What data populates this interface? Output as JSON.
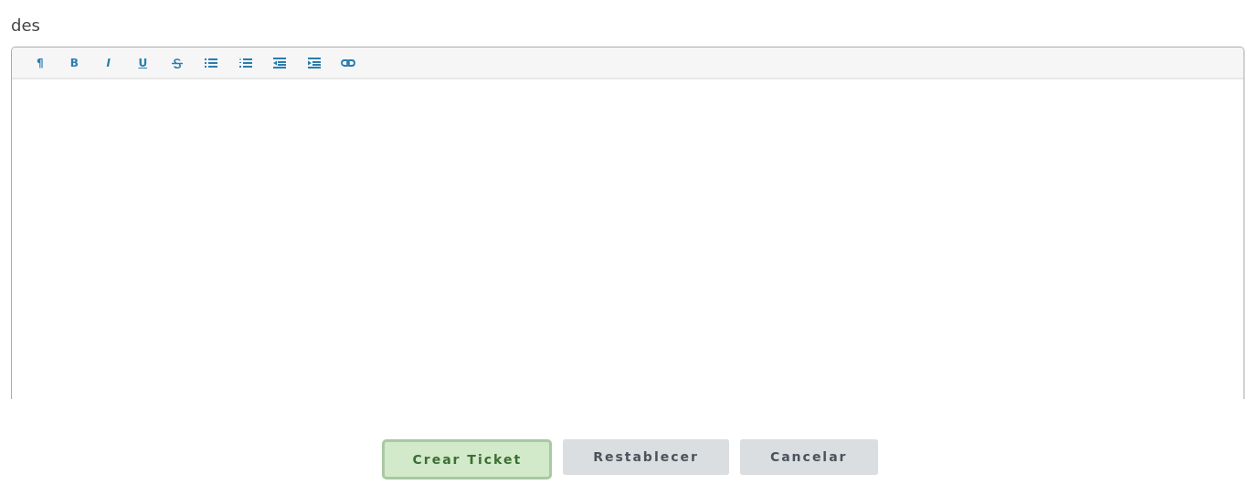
{
  "field_label": "des",
  "toolbar": [
    {
      "kind": "plain",
      "label": "¶"
    },
    {
      "kind": "bold",
      "label": "B"
    },
    {
      "kind": "italic",
      "label": "I"
    },
    {
      "kind": "underline",
      "label": "U"
    },
    {
      "kind": "strike"
    },
    {
      "kind": "bullets"
    },
    {
      "kind": "numbers"
    },
    {
      "kind": "outdent"
    },
    {
      "kind": "indent"
    },
    {
      "kind": "link"
    }
  ],
  "buttons": [
    {
      "label": "Crear Ticket",
      "kind": "success",
      "focused": true
    },
    {
      "label": "Restablecer",
      "kind": "secondary",
      "focused": false
    },
    {
      "label": "Cancelar",
      "kind": "secondary",
      "focused": false
    }
  ]
}
